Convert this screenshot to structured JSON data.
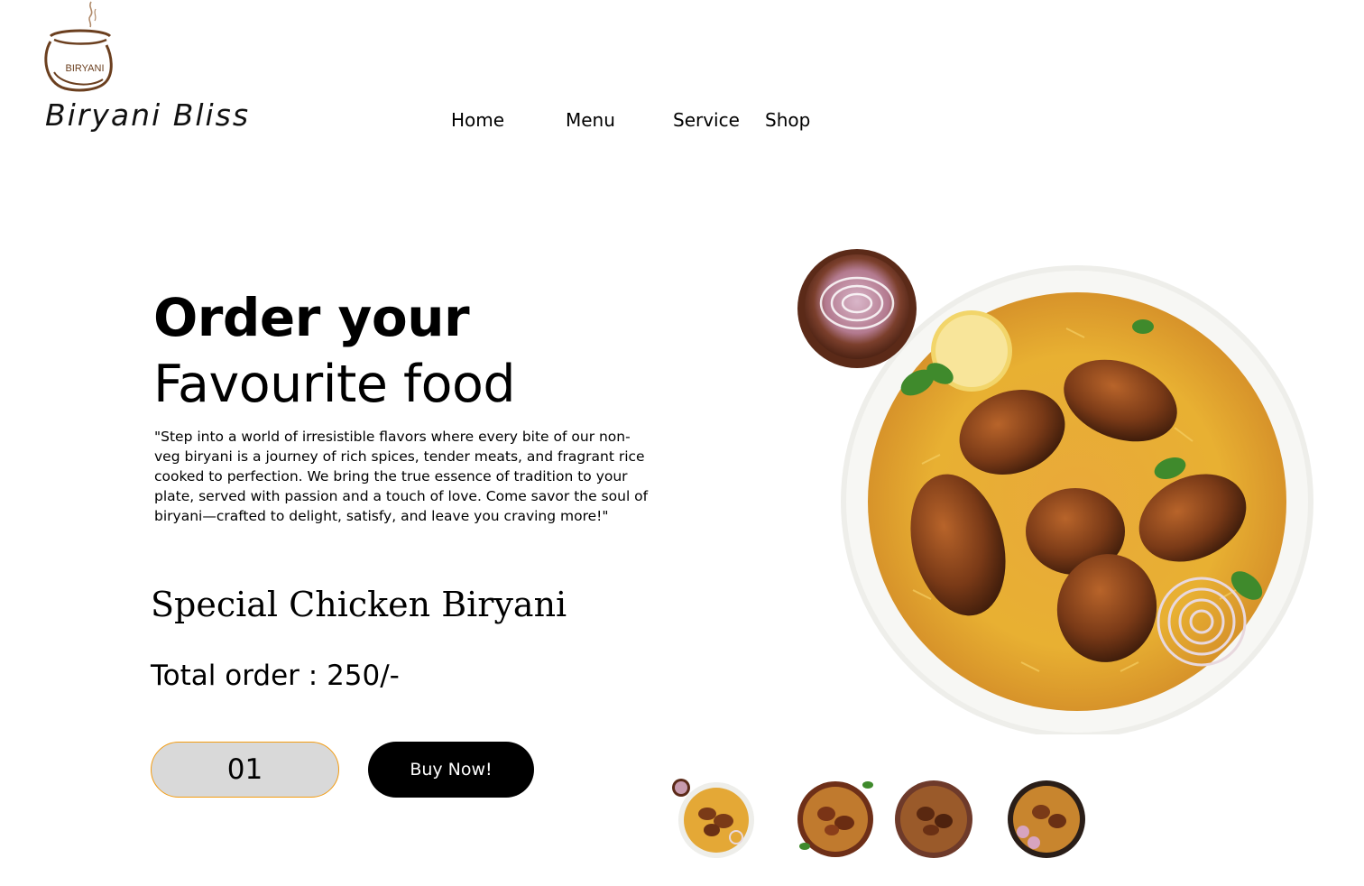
{
  "brand": {
    "logo_text": "BIRYANI",
    "name": "Biryani Bliss"
  },
  "nav": {
    "items": [
      {
        "label": "Home"
      },
      {
        "label": "Menu"
      },
      {
        "label": "Service"
      },
      {
        "label": "Shop"
      }
    ]
  },
  "hero": {
    "headline_line1": "Order your",
    "headline_line2": "Favourite food",
    "tagline": "\"Step into a world of irresistible flavors where every bite of our non-veg biryani is a journey of rich spices, tender meats, and fragrant rice cooked to perfection. We bring the true essence of tradition to your plate, served with passion and a touch of love. Come savor the soul of biryani—crafted to delight, satisfy, and leave you craving more!\"",
    "dish_name": "Special Chicken Biryani",
    "total_order": "Total order : 250/-"
  },
  "order": {
    "quantity": "01",
    "buy_label": "Buy Now!"
  },
  "colors": {
    "accent_border": "#f39c12",
    "quantity_bg": "#d9d9d9",
    "button_bg": "#000000",
    "logo_brown": "#6b3f1f"
  },
  "images": {
    "hero": "chicken-biryani-plate",
    "thumbnails": [
      "biryani-white-plate",
      "biryani-copper-bowl",
      "biryani-dark-bowl",
      "biryani-black-plate"
    ]
  }
}
